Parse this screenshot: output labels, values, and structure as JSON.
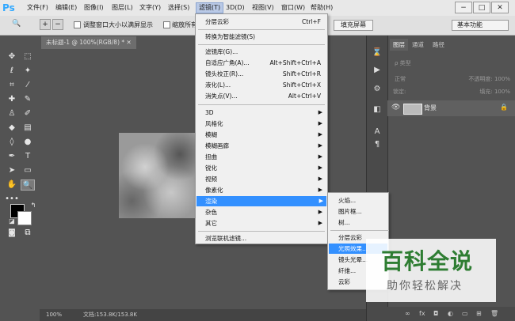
{
  "app": {
    "logo": "Ps"
  },
  "menubar": {
    "items": [
      "文件(F)",
      "编辑(E)",
      "图像(I)",
      "图层(L)",
      "文字(Y)",
      "选择(S)",
      "滤镜(T)",
      "3D(D)",
      "视图(V)",
      "窗口(W)",
      "帮助(H)"
    ],
    "window_buttons": [
      "−",
      "□",
      "✕"
    ]
  },
  "options_bar": {
    "checkbox1_label": "调整窗口大小以满屏显示",
    "checkbox2_label": "缩放所有",
    "fill_screen": "填充屏幕",
    "workspace": "基本功能"
  },
  "document": {
    "tab_title": "未标题-1 @ 100%(RGB/8) *  ✕",
    "zoom": "100%",
    "doc_info": "文档:153.8K/153.8K"
  },
  "filter_menu": {
    "items": [
      {
        "label": "分层云彩",
        "shortcut": "Ctrl+F"
      },
      {
        "label": "转换为智能滤镜(S)",
        "shortcut": ""
      },
      {
        "label": "滤镜库(G)...",
        "shortcut": ""
      },
      {
        "label": "自适应广角(A)...",
        "shortcut": "Alt+Shift+Ctrl+A"
      },
      {
        "label": "镜头校正(R)...",
        "shortcut": "Shift+Ctrl+R"
      },
      {
        "label": "液化(L)...",
        "shortcut": "Shift+Ctrl+X"
      },
      {
        "label": "消失点(V)...",
        "shortcut": "Alt+Ctrl+V"
      }
    ],
    "submenus": [
      "3D",
      "风格化",
      "模糊",
      "模糊画廊",
      "扭曲",
      "锐化",
      "视频",
      "像素化",
      "渲染",
      "杂色",
      "其它"
    ],
    "browse": "浏览联机滤镜..."
  },
  "render_submenu": {
    "items": [
      "火焰...",
      "图片框...",
      "树...",
      "分层云彩",
      "光照效果...",
      "镜头光晕...",
      "纤维...",
      "云彩"
    ]
  },
  "layers_panel": {
    "tabs": [
      "图层",
      "通道",
      "路径"
    ],
    "kind_filter": "ρ 类型",
    "blend_mode": "正常",
    "opacity": "不透明度: 100%",
    "lock_label": "锁定:",
    "fill": "填充: 100%",
    "layer_name": "背景"
  },
  "watermark": {
    "title": "百科全说",
    "subtitle": "助你轻松解决"
  }
}
